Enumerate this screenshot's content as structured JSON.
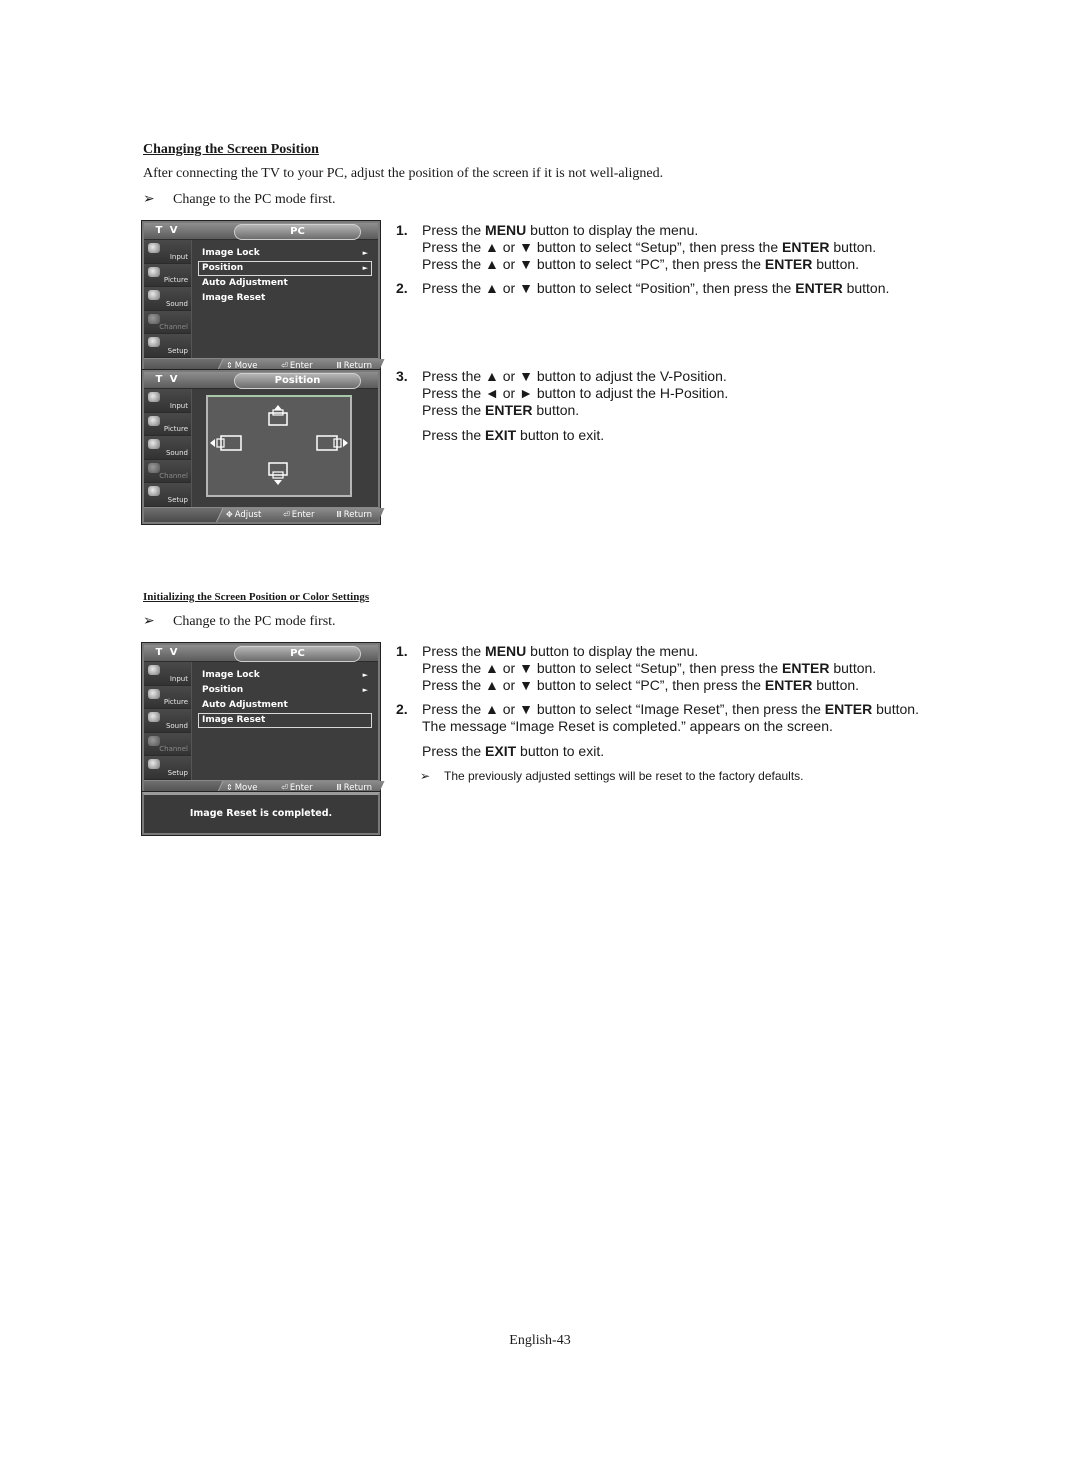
{
  "section1": {
    "title": "Changing the Screen Position",
    "intro": "After connecting the TV to your PC, adjust the position of the screen if it is not well-aligned.",
    "note": "Change to the PC mode first.",
    "osd_pc_menu": {
      "tv_label": "T V",
      "title": "PC",
      "sidebar": [
        {
          "label": "Input",
          "icon": "input-icon",
          "dim": false
        },
        {
          "label": "Picture",
          "icon": "picture-icon",
          "dim": false
        },
        {
          "label": "Sound",
          "icon": "sound-icon",
          "dim": false
        },
        {
          "label": "Channel",
          "icon": "channel-icon",
          "dim": true
        },
        {
          "label": "Setup",
          "icon": "setup-icon",
          "dim": false
        }
      ],
      "items": [
        {
          "label": "Image Lock",
          "arrow": "►",
          "selected": false
        },
        {
          "label": "Position",
          "arrow": "►",
          "selected": true
        },
        {
          "label": "Auto Adjustment",
          "arrow": "",
          "selected": false
        },
        {
          "label": "Image Reset",
          "arrow": "",
          "selected": false
        }
      ],
      "footer": {
        "move": "Move",
        "enter": "Enter",
        "return": "Return"
      }
    },
    "osd_position": {
      "tv_label": "T V",
      "title": "Position",
      "footer": {
        "adjust": "Adjust",
        "enter": "Enter",
        "return": "Return"
      }
    },
    "steps": [
      {
        "num": "1.",
        "lines": [
          [
            {
              "t": "Press the "
            },
            {
              "t": "MENU",
              "b": true
            },
            {
              "t": " button to display the menu."
            }
          ],
          [
            {
              "t": "Press the ▲ or ▼ button to select “Setup”, then press the "
            },
            {
              "t": "ENTER",
              "b": true
            },
            {
              "t": " button."
            }
          ],
          [
            {
              "t": "Press the ▲ or ▼ button to select “PC”, then press the "
            },
            {
              "t": "ENTER",
              "b": true
            },
            {
              "t": " button."
            }
          ]
        ]
      },
      {
        "num": "2.",
        "lines": [
          [
            {
              "t": "Press the ▲ or ▼ button to select “Position”, then press the "
            },
            {
              "t": "ENTER",
              "b": true
            },
            {
              "t": " button."
            }
          ]
        ]
      },
      {
        "num": "3.",
        "lines": [
          [
            {
              "t": "Press the ▲ or ▼ button to adjust the V-Position."
            }
          ],
          [
            {
              "t": "Press the ◄ or ► button to adjust the H-Position."
            }
          ],
          [
            {
              "t": "Press the "
            },
            {
              "t": "ENTER",
              "b": true
            },
            {
              "t": " button."
            }
          ]
        ]
      }
    ],
    "exit_line": [
      {
        "t": "Press the "
      },
      {
        "t": "EXIT",
        "b": true
      },
      {
        "t": " button to exit."
      }
    ]
  },
  "section2": {
    "title": "Initializing the Screen Position or Color Settings",
    "note": "Change to the PC mode first.",
    "osd_pc_menu": {
      "tv_label": "T V",
      "title": "PC",
      "sidebar": [
        {
          "label": "Input",
          "icon": "input-icon",
          "dim": false
        },
        {
          "label": "Picture",
          "icon": "picture-icon",
          "dim": false
        },
        {
          "label": "Sound",
          "icon": "sound-icon",
          "dim": false
        },
        {
          "label": "Channel",
          "icon": "channel-icon",
          "dim": true
        },
        {
          "label": "Setup",
          "icon": "setup-icon",
          "dim": false
        }
      ],
      "items": [
        {
          "label": "Image Lock",
          "arrow": "►",
          "selected": false
        },
        {
          "label": "Position",
          "arrow": "►",
          "selected": false
        },
        {
          "label": "Auto Adjustment",
          "arrow": "",
          "selected": false
        },
        {
          "label": "Image Reset",
          "arrow": "",
          "selected": true
        }
      ],
      "footer": {
        "move": "Move",
        "enter": "Enter",
        "return": "Return"
      }
    },
    "message": "Image Reset is completed.",
    "steps": [
      {
        "num": "1.",
        "lines": [
          [
            {
              "t": "Press the "
            },
            {
              "t": "MENU",
              "b": true
            },
            {
              "t": " button to display the menu."
            }
          ],
          [
            {
              "t": "Press the ▲ or ▼ button to select “Setup”, then press the "
            },
            {
              "t": "ENTER",
              "b": true
            },
            {
              "t": " button."
            }
          ],
          [
            {
              "t": "Press the ▲ or ▼ button to select “PC”, then press the "
            },
            {
              "t": "ENTER",
              "b": true
            },
            {
              "t": " button."
            }
          ]
        ]
      },
      {
        "num": "2.",
        "lines": [
          [
            {
              "t": "Press the ▲ or ▼ button to select “Image Reset”, then press the "
            },
            {
              "t": "ENTER",
              "b": true
            },
            {
              "t": " button."
            }
          ],
          [
            {
              "t": "The message “Image Reset is completed.” appears on the screen."
            }
          ]
        ]
      }
    ],
    "exit_line": [
      {
        "t": "Press the "
      },
      {
        "t": "EXIT",
        "b": true
      },
      {
        "t": " button to exit."
      }
    ],
    "subnote": "The previously adjusted settings will be reset to the factory defaults."
  },
  "page_label": "English-43",
  "note_glyph": "➢"
}
